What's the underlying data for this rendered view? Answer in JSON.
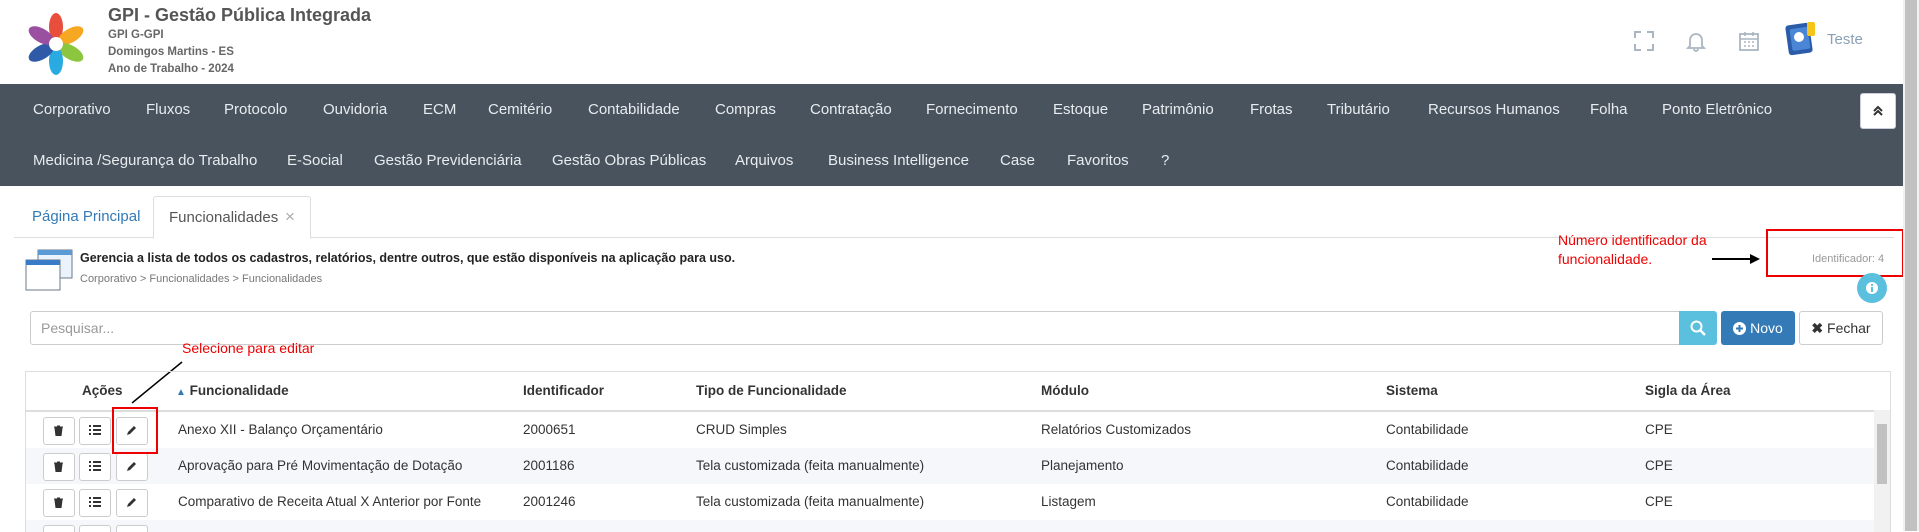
{
  "header": {
    "app_title": "GPI - Gestão Pública Integrada",
    "app_code": "GPI G-GPI",
    "location": "Domingos Martins - ES",
    "work_year": "Ano de Trabalho - 2024",
    "user_name": "Teste",
    "icons": [
      "fullscreen-icon",
      "bell-icon",
      "calendar-icon",
      "user-avatar"
    ]
  },
  "nav": {
    "row1": [
      "Corporativo",
      "Fluxos",
      "Protocolo",
      "Ouvidoria",
      "ECM",
      "Cemitério",
      "Contabilidade",
      "Compras",
      "Contratação",
      "Fornecimento",
      "Estoque",
      "Patrimônio",
      "Frotas",
      "Tributário",
      "Recursos Humanos",
      "Folha",
      "Ponto Eletrônico"
    ],
    "row2": [
      "Medicina /Segurança do Trabalho",
      "E-Social",
      "Gestão Previdenciária",
      "Gestão Obras Públicas",
      "Arquivos",
      "Business Intelligence",
      "Case",
      "Favoritos",
      "?"
    ],
    "collapse_icon": "chevron-double-up-icon"
  },
  "tabs": {
    "home": "Página Principal",
    "current": "Funcionalidades",
    "close": "×"
  },
  "page": {
    "description": "Gerencia a lista de todos os cadastros, relatórios, dentre outros, que estão disponíveis na aplicação para uso.",
    "breadcrumb": "Corporativo > Funcionalidades > Funcionalidades",
    "identifier": "Identificador: 4"
  },
  "annotations": {
    "id_note_line1": "Número identificador da",
    "id_note_line2": "funcionalidade.",
    "edit_note": "Selecione para editar",
    "color": "#e00000"
  },
  "search": {
    "placeholder": "Pesquisar...",
    "new_label": "Novo",
    "close_label": "Fechar"
  },
  "table": {
    "columns": [
      "Ações",
      "Funcionalidade",
      "Identificador",
      "Tipo de Funcionalidade",
      "Módulo",
      "Sistema",
      "Sigla da Área"
    ],
    "sort_indicator": "▲",
    "rows": [
      {
        "funcionalidade": "Anexo XII - Balanço Orçamentário",
        "identificador": "2000651",
        "tipo": "CRUD Simples",
        "modulo": "Relatórios Customizados",
        "sistema": "Contabilidade",
        "sigla": "CPE"
      },
      {
        "funcionalidade": "Aprovação para Pré Movimentação de Dotação",
        "identificador": "2001186",
        "tipo": "Tela customizada (feita manualmente)",
        "modulo": "Planejamento",
        "sistema": "Contabilidade",
        "sigla": "CPE"
      },
      {
        "funcionalidade": "Comparativo de Receita Atual X Anterior por Fonte",
        "identificador": "2001246",
        "tipo": "Tela customizada (feita manualmente)",
        "modulo": "Listagem",
        "sistema": "Contabilidade",
        "sigla": "CPE"
      }
    ]
  },
  "colors": {
    "navbar": "#48535e",
    "primary": "#337ab7",
    "info": "#5bc0de"
  }
}
